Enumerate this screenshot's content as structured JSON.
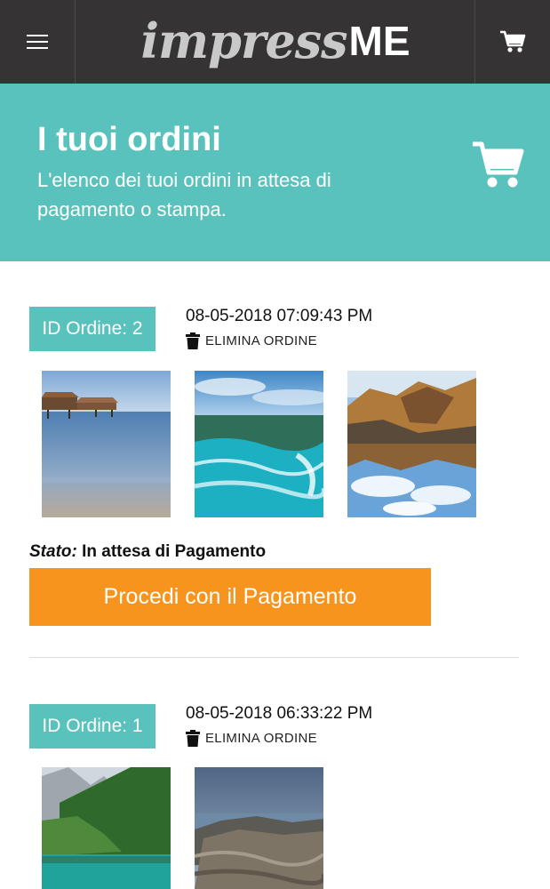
{
  "header": {
    "logo_script": "impress",
    "logo_me": "ME",
    "menu_icon": "hamburger-menu-icon",
    "cart_icon": "cart-icon"
  },
  "hero": {
    "title": "I tuoi ordini",
    "subtitle": "L'elenco dei tuoi ordini in attesa di pagamento o stampa.",
    "background": "#5ac2bc"
  },
  "orders": [
    {
      "id_label": "ID Ordine: 2",
      "date": "08-05-2018 07:09:43 PM",
      "delete_label": "ELIMINA ORDINE",
      "status_label": "Stato:",
      "status_value": "In attesa di Pagamento",
      "pay_label": "Procedi con il Pagamento",
      "photos": [
        "pier-on-lake-photo",
        "turquoise-waves-photo",
        "mountain-lake-reflection-photo"
      ]
    },
    {
      "id_label": "ID Ordine: 1",
      "date": "08-05-2018 06:33:22 PM",
      "delete_label": "ELIMINA ORDINE",
      "photos": [
        "alpine-lake-forest-photo",
        "rocky-coast-photo"
      ]
    }
  ],
  "colors": {
    "topbar": "#353334",
    "accent": "#5ac2bc",
    "pay_button": "#f7941d"
  }
}
